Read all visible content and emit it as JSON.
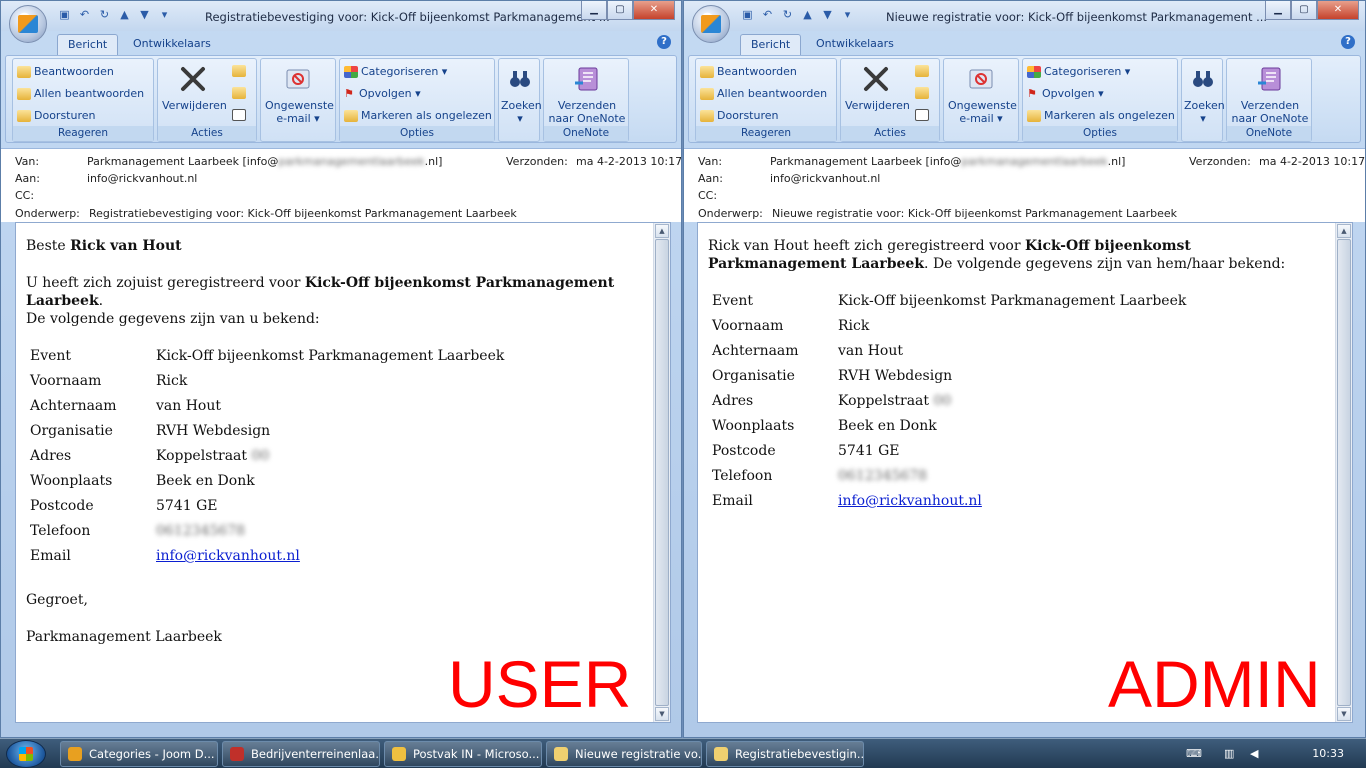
{
  "left": {
    "title": "Registratiebevestiging voor: Kick-Off bijeenkomst Parkmanagement ...",
    "header": {
      "from_label": "Van:",
      "from_name": "Parkmanagement Laarbeek [info@",
      "from_blur": "parkmanagementlaarbeek",
      "from_tail": ".nl]",
      "sent_label": "Verzonden:",
      "sent_value": "ma 4-2-2013 10:17",
      "to_label": "Aan:",
      "to_value": "info@rickvanhout.nl",
      "cc_label": "CC:",
      "subject_label": "Onderwerp:",
      "subject_value": "Registratiebevestiging voor: Kick-Off bijeenkomst Parkmanagement Laarbeek"
    },
    "greeting_pre": "Beste ",
    "greeting_name": "Rick van Hout",
    "intro_pre": "U heeft zich zojuist geregistreerd voor ",
    "intro_event": "Kick-Off bijeenkomst Parkmanagement Laarbeek",
    "intro_post": ".",
    "intro_line2": "De volgende gegevens zijn van u bekend:",
    "closing": "Gegroet,",
    "signature": "Parkmanagement Laarbeek",
    "stamp": "USER"
  },
  "right": {
    "title": "Nieuwe registratie voor: Kick-Off bijeenkomst Parkmanagement ...",
    "header": {
      "from_label": "Van:",
      "from_name": "Parkmanagement Laarbeek [info@",
      "from_blur": "parkmanagementlaarbeek",
      "from_tail": ".nl]",
      "sent_label": "Verzonden:",
      "sent_value": "ma 4-2-2013 10:17",
      "to_label": "Aan:",
      "to_value": "info@rickvanhout.nl",
      "cc_label": "CC:",
      "subject_label": "Onderwerp:",
      "subject_value": "Nieuwe registratie voor: Kick-Off bijeenkomst Parkmanagement Laarbeek"
    },
    "intro_pre": "Rick van Hout heeft zich geregistreerd voor ",
    "intro_event": "Kick-Off bijeenkomst Parkmanagement Laarbeek",
    "intro_post": ". De volgende gegevens zijn van hem/haar bekend:",
    "stamp": "ADMIN"
  },
  "ribbon": {
    "tab_bericht": "Bericht",
    "tab_ontwikkelaars": "Ontwikkelaars",
    "beantwoorden": "Beantwoorden",
    "allen_beantwoorden": "Allen beantwoorden",
    "doorsturen": "Doorsturen",
    "group_reageren": "Reageren",
    "verwijderen": "Verwijderen",
    "group_acties": "Acties",
    "ongewenste_1": "Ongewenste",
    "ongewenste_2": "e-mail ▾",
    "categoriseren": "Categoriseren ▾",
    "opvolgen": "Opvolgen ▾",
    "markeren": "Markeren als ongelezen",
    "group_opties": "Opties",
    "zoeken": "Zoeken",
    "zoeken_arrow": "▾",
    "verzenden_1": "Verzenden",
    "verzenden_2": "naar OneNote",
    "group_onenote": "OneNote"
  },
  "fields": [
    {
      "label": "Event",
      "value": "Kick-Off bijeenkomst Parkmanagement Laarbeek"
    },
    {
      "label": "Voornaam",
      "value": "Rick"
    },
    {
      "label": "Achternaam",
      "value": "van Hout"
    },
    {
      "label": "Organisatie",
      "value": "RVH Webdesign"
    },
    {
      "label": "Adres",
      "value": "Koppelstraat",
      "blur": "00"
    },
    {
      "label": "Woonplaats",
      "value": "Beek en Donk"
    },
    {
      "label": "Postcode",
      "value": "5741 GE"
    },
    {
      "label": "Telefoon",
      "value": "",
      "blur": "0612345678"
    },
    {
      "label": "Email",
      "value": "info@rickvanhout.nl",
      "link": true
    }
  ],
  "taskbar": {
    "items": [
      {
        "label": "Categories - Joom D...",
        "color": "#e8a020"
      },
      {
        "label": "Bedrijventerreinenlaa...",
        "color": "#c0302a"
      },
      {
        "label": "Postvak IN - Microso...",
        "color": "#f0c040"
      },
      {
        "label": "Nieuwe registratie vo...",
        "color": "#f0d070"
      },
      {
        "label": "Registratiebevestigin...",
        "color": "#f0d070"
      }
    ],
    "clock": "10:33"
  }
}
